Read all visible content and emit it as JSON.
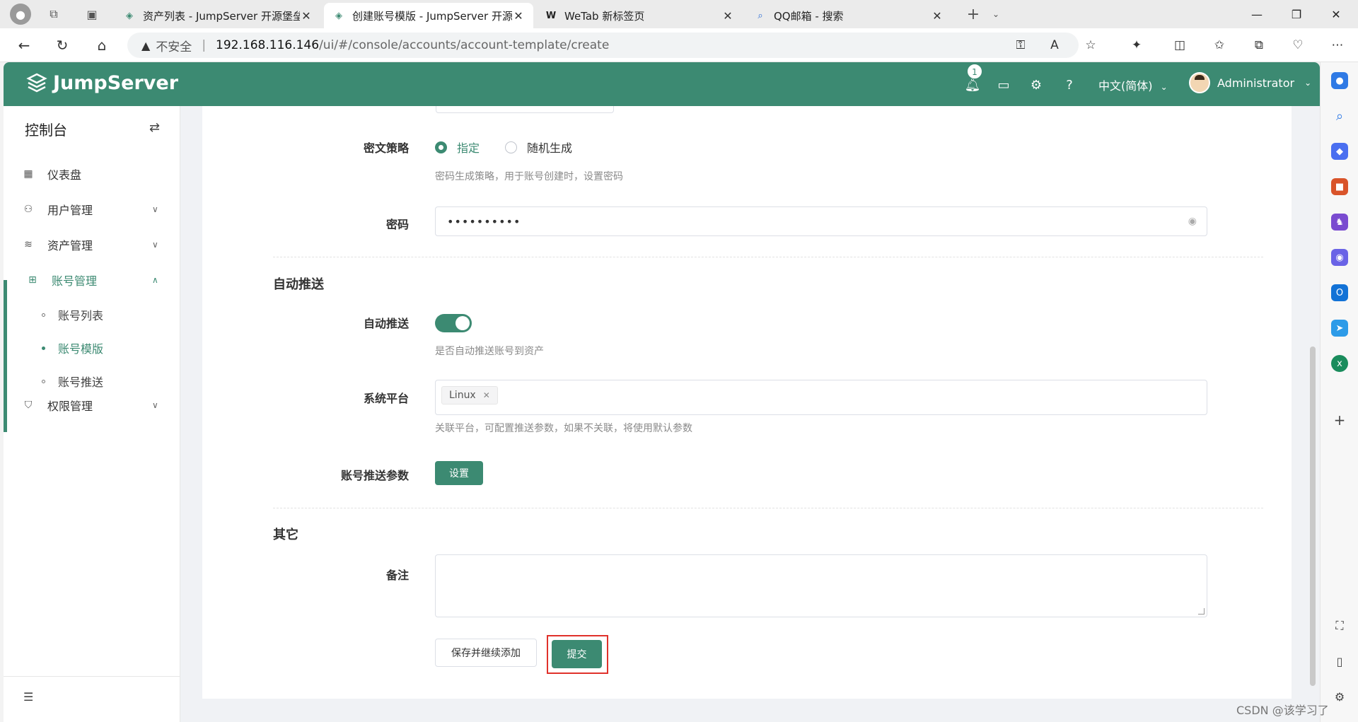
{
  "browser": {
    "tabs": [
      {
        "title": "资产列表 - JumpServer 开源堡垒",
        "active": false
      },
      {
        "title": "创建账号模版 - JumpServer 开源",
        "active": true
      },
      {
        "title": "WeTab 新标签页",
        "active": false
      },
      {
        "title": "QQ邮箱 - 搜索",
        "active": false
      }
    ],
    "address": {
      "insecure_label": "不安全",
      "separator": "|",
      "host": "192.168.116.146",
      "path": "/ui/#/console/accounts/account-template/create"
    }
  },
  "header": {
    "brand": "JumpServer",
    "notification_count": "1",
    "language": "中文(简体)",
    "username": "Administrator",
    "colors": {
      "primary": "#3c8a72"
    }
  },
  "sidebar": {
    "title": "控制台",
    "items": [
      {
        "label": "仪表盘",
        "icon": "dashboard-icon"
      },
      {
        "label": "用户管理",
        "icon": "users-icon"
      },
      {
        "label": "资产管理",
        "icon": "assets-icon"
      },
      {
        "label": "账号管理",
        "icon": "accounts-icon"
      },
      {
        "label": "权限管理",
        "icon": "permissions-icon"
      }
    ],
    "sub_items": [
      {
        "label": "账号列表",
        "active": false
      },
      {
        "label": "账号模版",
        "active": true
      },
      {
        "label": "账号推送",
        "active": false
      }
    ]
  },
  "form": {
    "secret_strategy": {
      "label": "密文策略",
      "options": [
        "指定",
        "随机生成"
      ],
      "selected": "指定",
      "hint": "密码生成策略，用于账号创建时，设置密码"
    },
    "password": {
      "label": "密码",
      "value": "••••••••••"
    },
    "auto_push_section": "自动推送",
    "auto_push": {
      "label": "自动推送",
      "enabled": true,
      "hint": "是否自动推送账号到资产"
    },
    "platforms": {
      "label": "系统平台",
      "tags": [
        "Linux"
      ],
      "hint": "关联平台，可配置推送参数，如果不关联，将使用默认参数"
    },
    "push_params": {
      "label": "账号推送参数",
      "button": "设置"
    },
    "other_section": "其它",
    "comment": {
      "label": "备注",
      "value": ""
    },
    "buttons": {
      "save_continue": "保存并继续添加",
      "submit": "提交"
    }
  },
  "watermark": "CSDN @该学习了"
}
